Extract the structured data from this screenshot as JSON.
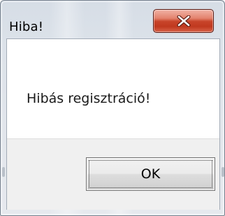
{
  "window": {
    "title": "Hiba!",
    "close_icon": "close-icon",
    "accent": "#c8442a",
    "frame_color": "#dde3ea"
  },
  "content": {
    "message": "Hibás regisztráció!"
  },
  "buttons": {
    "ok_label": "OK"
  }
}
